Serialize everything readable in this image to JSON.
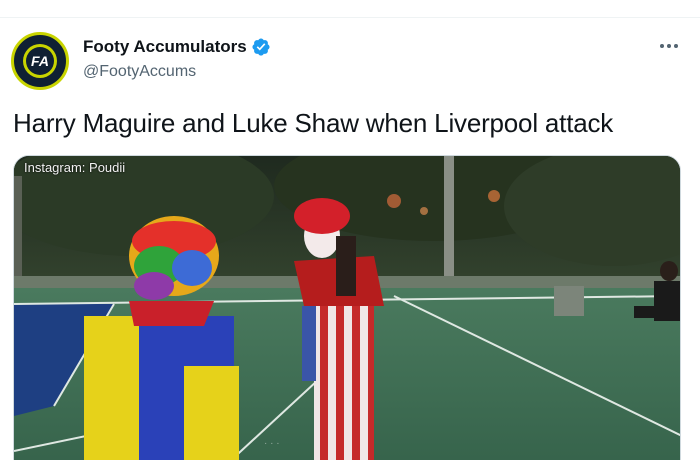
{
  "tweet": {
    "author": {
      "display_name": "Footy Accumulators",
      "handle": "@FootyAccums",
      "avatar_icon": "footy-accumulators-logo",
      "avatar_ring_text": "FOOTY ACCUMULATORS",
      "avatar_initials": "FA",
      "verified": true,
      "verified_icon": "verified-badge-icon"
    },
    "more_icon": "more-options-icon",
    "text": "Harry Maguire and Luke Shaw when Liverpool attack",
    "media": {
      "type": "video-still",
      "watermark": "Instagram: Poudii"
    }
  },
  "colors": {
    "verified": "#1d9bf0",
    "name": "#0f1419",
    "secondary": "#536471",
    "court": "#3a6a52",
    "court_blue": "#1e3f82",
    "avatar_bg": "#0f2033",
    "avatar_accent": "#c8d400"
  }
}
